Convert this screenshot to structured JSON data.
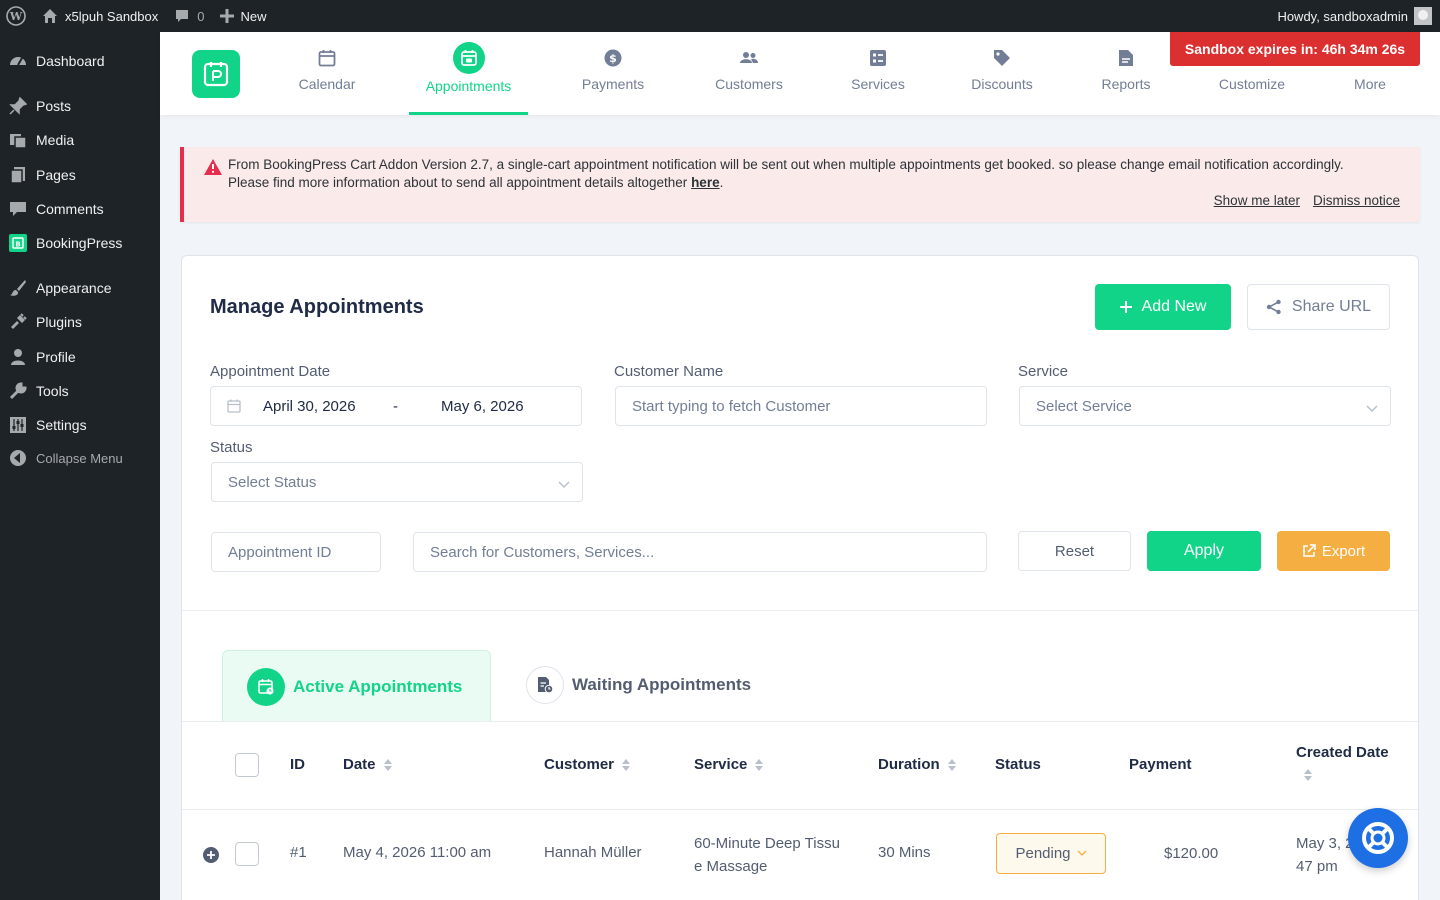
{
  "adminbar": {
    "site_name": "x5lpuh Sandbox",
    "comments_count": "0",
    "new_label": "New",
    "howdy": "Howdy, sandboxadmin"
  },
  "sidebar": {
    "items": [
      {
        "label": "Dashboard",
        "icon": "dashboard-icon"
      },
      {
        "label": "Posts",
        "icon": "pin-icon"
      },
      {
        "label": "Media",
        "icon": "media-icon"
      },
      {
        "label": "Pages",
        "icon": "pages-icon"
      },
      {
        "label": "Comments",
        "icon": "comment-icon"
      },
      {
        "label": "BookingPress",
        "icon": "bookingpress-icon"
      },
      {
        "label": "Appearance",
        "icon": "brush-icon"
      },
      {
        "label": "Plugins",
        "icon": "plug-icon"
      },
      {
        "label": "Profile",
        "icon": "user-icon"
      },
      {
        "label": "Tools",
        "icon": "wrench-icon"
      },
      {
        "label": "Settings",
        "icon": "sliders-icon"
      },
      {
        "label": "Collapse Menu",
        "icon": "collapse-icon"
      }
    ]
  },
  "nav": {
    "items": [
      {
        "label": "Calendar",
        "icon": "calendar-icon"
      },
      {
        "label": "Appointments",
        "icon": "appointments-icon",
        "active": true
      },
      {
        "label": "Payments",
        "icon": "dollar-icon"
      },
      {
        "label": "Customers",
        "icon": "users-icon"
      },
      {
        "label": "Services",
        "icon": "services-icon"
      },
      {
        "label": "Discounts",
        "icon": "tag-icon"
      },
      {
        "label": "Reports",
        "icon": "report-icon"
      },
      {
        "label": "Customize",
        "icon": "customize-icon"
      },
      {
        "label": "More",
        "icon": "more-icon"
      }
    ],
    "sandbox_expiry": "Sandbox expires in: 46h 34m 26s"
  },
  "notice": {
    "message": "From BookingPress Cart Addon Version 2.7, a single-cart appointment notification will be sent out when multiple appointments get booked. so please change email notification accordingly. Please find more information about to send all appointment details altogether",
    "link_text": "here",
    "after_link": ".",
    "show_later": "Show me later",
    "dismiss": "Dismiss notice"
  },
  "manage": {
    "title": "Manage Appointments",
    "add_new": "Add New",
    "share_url": "Share URL",
    "filters": {
      "date_label": "Appointment Date",
      "date_from": "April 30, 2026",
      "date_separator": "-",
      "date_to": "May 6, 2026",
      "customer_label": "Customer Name",
      "customer_placeholder": "Start typing to fetch Customer",
      "service_label": "Service",
      "service_placeholder": "Select Service",
      "status_label": "Status",
      "status_placeholder": "Select Status",
      "appointment_id_placeholder": "Appointment ID",
      "search_placeholder": "Search for Customers, Services...",
      "reset": "Reset",
      "apply": "Apply",
      "export": "Export"
    }
  },
  "tabs": {
    "active": "Active Appointments",
    "waiting": "Waiting Appointments"
  },
  "table": {
    "headers": {
      "id": "ID",
      "date": "Date",
      "customer": "Customer",
      "service": "Service",
      "duration": "Duration",
      "status": "Status",
      "payment": "Payment",
      "created": "Created Date"
    },
    "rows": [
      {
        "id": "#1",
        "date": "May 4, 2026 11:00 am",
        "customer": "Hannah Müller",
        "service_line1": "60-Minute Deep Tissu",
        "service_line2": "e Massage",
        "duration": "30 Mins",
        "status": "Pending",
        "payment": "$120.00",
        "created_line1": "May 3, 2",
        "created_line2": "47 pm"
      }
    ]
  },
  "colors": {
    "brand_green": "#12d488",
    "admin_dark": "#1d2327",
    "sandbox_red": "#dc2f2f",
    "export_orange": "#f5ae41",
    "help_blue": "#1d6fe3"
  }
}
